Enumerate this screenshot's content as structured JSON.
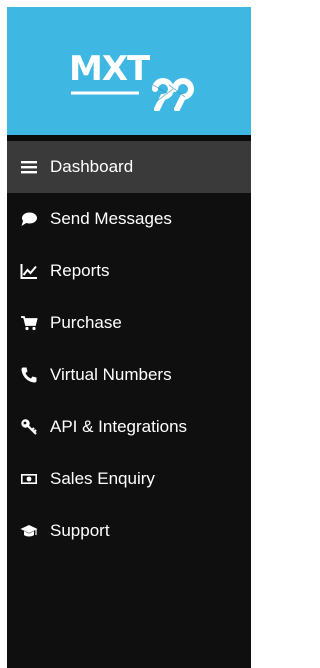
{
  "logo": {
    "text": "MXT",
    "suffix": "99"
  },
  "menu": {
    "items": [
      {
        "label": "Dashboard",
        "icon": "menu-bars-icon"
      },
      {
        "label": "Send Messages",
        "icon": "chat-bubble-icon"
      },
      {
        "label": "Reports",
        "icon": "line-chart-icon"
      },
      {
        "label": "Purchase",
        "icon": "cart-icon"
      },
      {
        "label": "Virtual Numbers",
        "icon": "phone-icon"
      },
      {
        "label": "API & Integrations",
        "icon": "key-icon"
      },
      {
        "label": "Sales Enquiry",
        "icon": "money-icon"
      },
      {
        "label": "Support",
        "icon": "graduation-cap-icon"
      }
    ],
    "active_index": 0
  },
  "colors": {
    "header_bg": "#3fb7e3",
    "sidebar_bg": "#0f0f0f",
    "active_item_bg": "#3a3a3a",
    "text": "#ffffff"
  }
}
